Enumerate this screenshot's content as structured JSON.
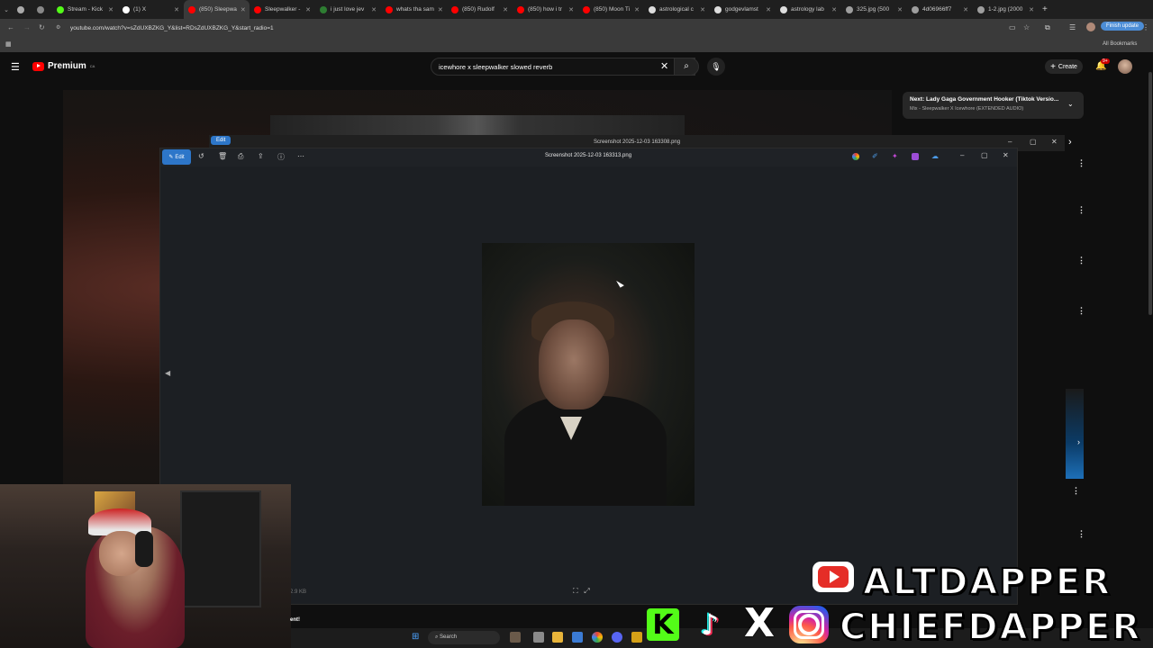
{
  "browser": {
    "tabs": [
      {
        "label": "",
        "color": "#aaaaaa"
      },
      {
        "label": "",
        "color": "#888888"
      },
      {
        "label": "Stream - Kick",
        "color": "#53fc18"
      },
      {
        "label": "(1) X",
        "color": "#ffffff"
      },
      {
        "label": "(850) Sleepwa",
        "color": "#ff0000",
        "active": true
      },
      {
        "label": "Sleepwalker -",
        "color": "#ff0000"
      },
      {
        "label": "i just love jev",
        "color": "#2e7d32"
      },
      {
        "label": "whats tha sam",
        "color": "#ff0000"
      },
      {
        "label": "(850) Rudolf",
        "color": "#ff0000"
      },
      {
        "label": "(850) how i tr",
        "color": "#ff0000"
      },
      {
        "label": "(850) Moon Ti",
        "color": "#ff0000"
      },
      {
        "label": "astrological c",
        "color": "#dddddd"
      },
      {
        "label": "godgevlamst",
        "color": "#dddddd"
      },
      {
        "label": "astrology lab",
        "color": "#dddddd"
      },
      {
        "label": "325.jpg (500",
        "color": "#9e9e9e"
      },
      {
        "label": "4d06966ff7",
        "color": "#9e9e9e"
      },
      {
        "label": "1-2.jpg (2000",
        "color": "#9e9e9e"
      }
    ],
    "url": "youtube.com/watch?v=sZdUXBZKG_Y&list=RDsZdUXBZKG_Y&start_radio=1",
    "finish_update": "Finish update",
    "all_bookmarks": "All Bookmarks"
  },
  "youtube": {
    "logo_text": "Premium",
    "logo_sup": "CA",
    "search_value": "icewhore x sleepwalker slowed reverb",
    "create_label": "Create",
    "notif_badge": "9+",
    "next_title": "Next: Lady Gaga Government Hooker (Tiktok Versio...",
    "next_sub": "Mix - Sleepwalker X Icewhore (EXTENDED AUDIO)"
  },
  "photo_back": {
    "title": "Screenshot 2025-12-03 163308.png",
    "edit_label": "Edit"
  },
  "photo_front": {
    "title": "Screenshot 2025-12-03 163313.png",
    "edit_label": "Edit",
    "file_size": "2.9 KB"
  },
  "taskbar": {
    "search_label": "Search",
    "left_text": "ent!"
  },
  "overlay": {
    "alt_name": "ALTDAPPER",
    "chief_name": "CHIEFDAPPER",
    "kick_glyph": "K",
    "tiktok_glyph": "♪",
    "x_glyph": "X"
  },
  "colors": {
    "youtube_red": "#ff0000",
    "edit_blue": "#2d76c9",
    "kick_green": "#53fc18"
  }
}
